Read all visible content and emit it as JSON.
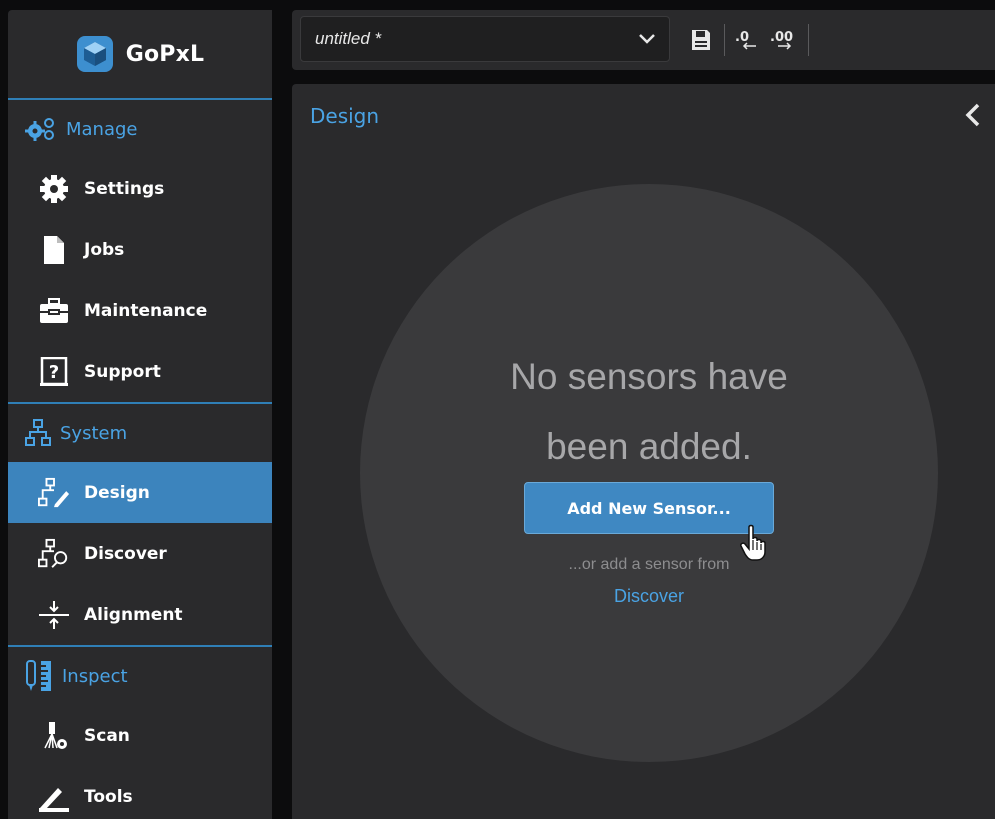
{
  "app": {
    "name": "GoPxL"
  },
  "sidebar": {
    "sections": [
      {
        "label": "Manage",
        "items": [
          {
            "label": "Settings"
          },
          {
            "label": "Jobs"
          },
          {
            "label": "Maintenance"
          },
          {
            "label": "Support"
          }
        ]
      },
      {
        "label": "System",
        "items": [
          {
            "label": "Design",
            "active": true
          },
          {
            "label": "Discover"
          },
          {
            "label": "Alignment"
          }
        ]
      },
      {
        "label": "Inspect",
        "items": [
          {
            "label": "Scan"
          },
          {
            "label": "Tools"
          }
        ]
      }
    ]
  },
  "toolbar": {
    "job_name": "untitled *",
    "buttons": [
      {
        "icon": "save-icon"
      },
      {
        "icon": "import-icon"
      },
      {
        "icon": "export-icon"
      }
    ]
  },
  "panel": {
    "title": "Design",
    "empty_line1": "No sensors have",
    "empty_line2": "been added.",
    "add_button": "Add New Sensor...",
    "or_text": "...or add a sensor from",
    "discover_link": "Discover"
  },
  "colors": {
    "accent": "#4aa3e4",
    "active_item": "#3c84bd",
    "panel_bg": "#2a2a2c",
    "circle_bg": "#3a3a3c"
  }
}
